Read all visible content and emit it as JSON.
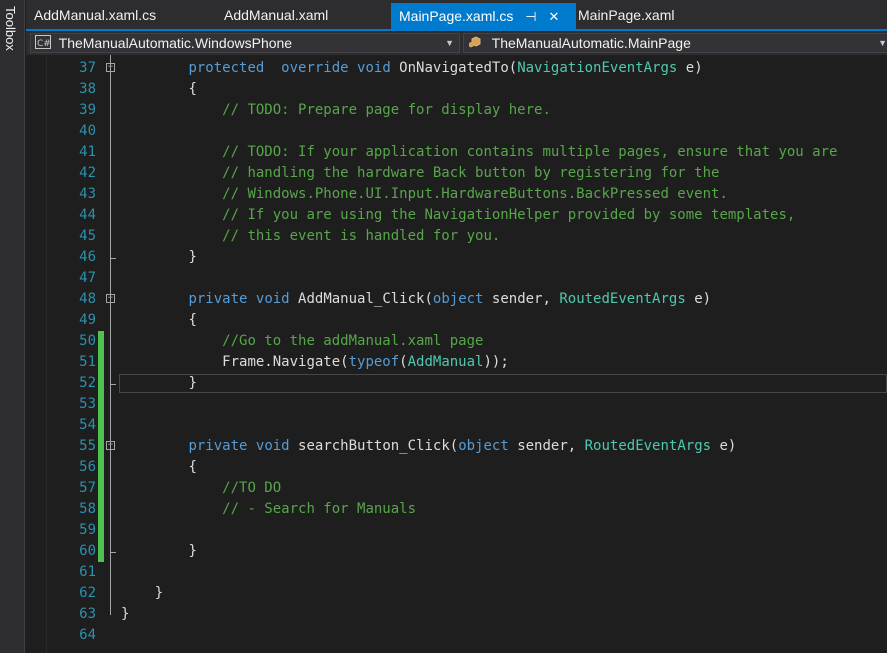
{
  "toolbox": {
    "label": "Toolbox"
  },
  "tabs": [
    {
      "label": "AddManual.xaml.cs",
      "active": false
    },
    {
      "label": "AddManual.xaml",
      "active": false
    },
    {
      "label": "MainPage.xaml.cs",
      "active": true,
      "pin_icon": "⊣",
      "close_icon": "✕"
    },
    {
      "label": "MainPage.xaml",
      "active": false
    }
  ],
  "navigation": {
    "project_combo": {
      "value": "TheManualAutomatic.WindowsPhone",
      "icon": "csharp-project-icon"
    },
    "type_combo": {
      "value": "TheManualAutomatic.MainPage",
      "icon": "class-icon"
    }
  },
  "editor": {
    "lines": [
      {
        "n": "37",
        "indent": 8,
        "tokens": [
          [
            "kw",
            "protected"
          ],
          [
            "",
            "  "
          ],
          [
            "kw",
            "override"
          ],
          [
            "",
            "",
            " "
          ],
          [
            "kw",
            "void"
          ],
          [
            "",
            " OnNavigatedTo("
          ],
          [
            "ty",
            "NavigationEventArgs"
          ],
          [
            "",
            " e)"
          ]
        ]
      },
      {
        "n": "38",
        "indent": 8,
        "tokens": [
          [
            "",
            "{"
          ]
        ]
      },
      {
        "n": "39",
        "indent": 12,
        "tokens": [
          [
            "cm",
            "// TODO: Prepare page for display here."
          ]
        ]
      },
      {
        "n": "40",
        "indent": 0,
        "tokens": []
      },
      {
        "n": "41",
        "indent": 12,
        "tokens": [
          [
            "cm",
            "// TODO: If your application contains multiple pages, ensure that you are"
          ]
        ]
      },
      {
        "n": "42",
        "indent": 12,
        "tokens": [
          [
            "cm",
            "// handling the hardware Back button by registering for the"
          ]
        ]
      },
      {
        "n": "43",
        "indent": 12,
        "tokens": [
          [
            "cm",
            "// Windows.Phone.UI.Input.HardwareButtons.BackPressed event."
          ]
        ]
      },
      {
        "n": "44",
        "indent": 12,
        "tokens": [
          [
            "cm",
            "// If you are using the NavigationHelper provided by some templates,"
          ]
        ]
      },
      {
        "n": "45",
        "indent": 12,
        "tokens": [
          [
            "cm",
            "// this event is handled for you."
          ]
        ]
      },
      {
        "n": "46",
        "indent": 8,
        "tokens": [
          [
            "",
            "}"
          ]
        ]
      },
      {
        "n": "47",
        "indent": 0,
        "tokens": []
      },
      {
        "n": "48",
        "indent": 8,
        "tokens": [
          [
            "kw",
            "private"
          ],
          [
            "",
            " "
          ],
          [
            "kw",
            "void"
          ],
          [
            "",
            " AddManual_Click("
          ],
          [
            "kw",
            "object"
          ],
          [
            "",
            " sender, "
          ],
          [
            "ty",
            "RoutedEventArgs"
          ],
          [
            "",
            " e)"
          ]
        ]
      },
      {
        "n": "49",
        "indent": 8,
        "tokens": [
          [
            "",
            "{"
          ]
        ]
      },
      {
        "n": "50",
        "indent": 12,
        "tokens": [
          [
            "cm",
            "//Go to the addManual.xaml page"
          ]
        ]
      },
      {
        "n": "51",
        "indent": 12,
        "tokens": [
          [
            "",
            "Frame.Navigate("
          ],
          [
            "kw",
            "typeof"
          ],
          [
            "",
            "("
          ],
          [
            "ty",
            "AddManual"
          ],
          [
            "",
            "));"
          ]
        ]
      },
      {
        "n": "52",
        "indent": 8,
        "tokens": [
          [
            "",
            "}"
          ]
        ]
      },
      {
        "n": "53",
        "indent": 0,
        "tokens": []
      },
      {
        "n": "54",
        "indent": 0,
        "tokens": []
      },
      {
        "n": "55",
        "indent": 8,
        "tokens": [
          [
            "kw",
            "private"
          ],
          [
            "",
            " "
          ],
          [
            "kw",
            "void"
          ],
          [
            "",
            " searchButton_Click("
          ],
          [
            "kw",
            "object"
          ],
          [
            "",
            " sender, "
          ],
          [
            "ty",
            "RoutedEventArgs"
          ],
          [
            "",
            " e)"
          ]
        ]
      },
      {
        "n": "56",
        "indent": 8,
        "tokens": [
          [
            "",
            "{"
          ]
        ]
      },
      {
        "n": "57",
        "indent": 12,
        "tokens": [
          [
            "cm",
            "//TO DO"
          ]
        ]
      },
      {
        "n": "58",
        "indent": 12,
        "tokens": [
          [
            "cm",
            "// - Search for Manuals"
          ]
        ]
      },
      {
        "n": "59",
        "indent": 0,
        "tokens": []
      },
      {
        "n": "60",
        "indent": 8,
        "tokens": [
          [
            "",
            "}"
          ]
        ]
      },
      {
        "n": "61",
        "indent": 0,
        "tokens": []
      },
      {
        "n": "62",
        "indent": 4,
        "tokens": [
          [
            "",
            "}"
          ]
        ]
      },
      {
        "n": "63",
        "indent": 0,
        "tokens": [
          [
            "",
            "}"
          ]
        ]
      },
      {
        "n": "64",
        "indent": 0,
        "tokens": []
      }
    ],
    "changed_lines": [
      "50",
      "51",
      "52",
      "53",
      "54",
      "55",
      "56",
      "57",
      "58",
      "59",
      "60"
    ],
    "fold_markers": [
      "37",
      "48",
      "55",
      "63"
    ],
    "current_line": "52"
  },
  "colors": {
    "keyword": "#569cd6",
    "type": "#4ec9b0",
    "comment": "#57a64a",
    "line_number": "#2b91af",
    "change_marker": "#4ec14e",
    "accent": "#007acc"
  }
}
